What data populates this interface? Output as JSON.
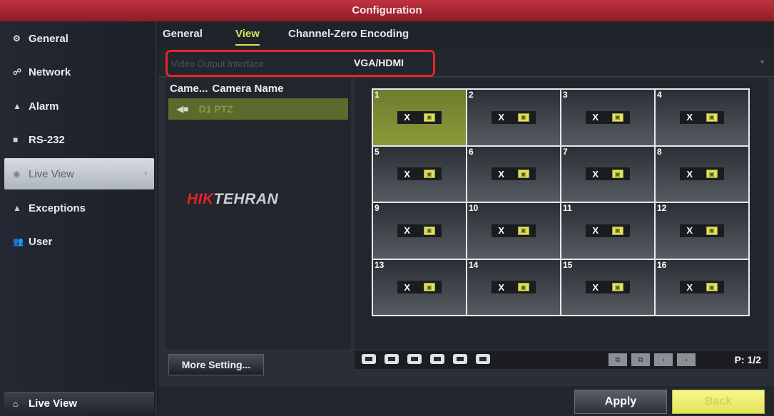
{
  "window": {
    "title": "Configuration"
  },
  "sidebar": {
    "items": [
      {
        "label": "General",
        "icon": "gear-icon"
      },
      {
        "label": "Network",
        "icon": "network-icon"
      },
      {
        "label": "Alarm",
        "icon": "alarm-icon"
      },
      {
        "label": "RS-232",
        "icon": "serial-port-icon"
      },
      {
        "label": "Live View",
        "icon": "eye-icon",
        "active": true
      },
      {
        "label": "Exceptions",
        "icon": "warning-icon"
      },
      {
        "label": "User",
        "icon": "users-icon"
      }
    ],
    "bottom_label": "Live View"
  },
  "tabs": [
    {
      "label": "General"
    },
    {
      "label": "View",
      "active": true
    },
    {
      "label": "Channel-Zero Encoding"
    }
  ],
  "output": {
    "label": "Video Output Interface",
    "value": "VGA/HDMI"
  },
  "camera_list": {
    "headers": [
      "Came...",
      "Camera Name"
    ],
    "rows": [
      {
        "name": "D1  PTZ"
      }
    ]
  },
  "watermark": {
    "brand_red": "HIK",
    "brand_rest": "TEHRAN"
  },
  "grid": {
    "cells": [
      {
        "num": "1",
        "selected": true
      },
      {
        "num": "2"
      },
      {
        "num": "3"
      },
      {
        "num": "4"
      },
      {
        "num": "5"
      },
      {
        "num": "6"
      },
      {
        "num": "7"
      },
      {
        "num": "8"
      },
      {
        "num": "9"
      },
      {
        "num": "10"
      },
      {
        "num": "11"
      },
      {
        "num": "12"
      },
      {
        "num": "13"
      },
      {
        "num": "14"
      },
      {
        "num": "15"
      },
      {
        "num": "16"
      }
    ],
    "remove_glyph": "X"
  },
  "pagination": {
    "label": "P: 1/2"
  },
  "buttons": {
    "more_setting": "More Setting...",
    "apply": "Apply",
    "back": "Back"
  },
  "colors": {
    "title_red": "#b02a36",
    "accent_yellow": "#d8e65a",
    "highlight_red": "#e32626",
    "selected_cell": "#7a8934"
  }
}
